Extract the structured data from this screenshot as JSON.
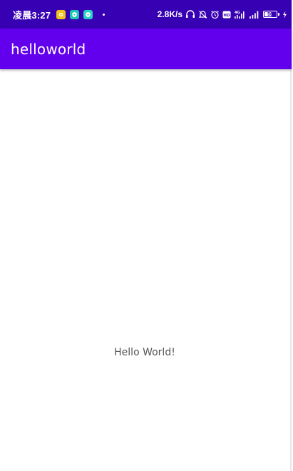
{
  "status_bar": {
    "time": "凌晨3:27",
    "network_speed": "2.8K/s",
    "battery_level": "56",
    "icons": [
      "headset-icon",
      "bell-off-icon",
      "alarm-icon",
      "hd-icon",
      "4g-signal-icon",
      "signal-icon",
      "battery-icon",
      "charging-icon"
    ],
    "notification_badges": [
      "app-yellow-icon",
      "app-teal-icon",
      "app-teal-icon"
    ]
  },
  "app_bar": {
    "title": "helloworld"
  },
  "main": {
    "message": "Hello World!"
  },
  "colors": {
    "status_bar": "#3700b3",
    "app_bar": "#6200ee",
    "background": "#ffffff",
    "text": "#555555"
  }
}
